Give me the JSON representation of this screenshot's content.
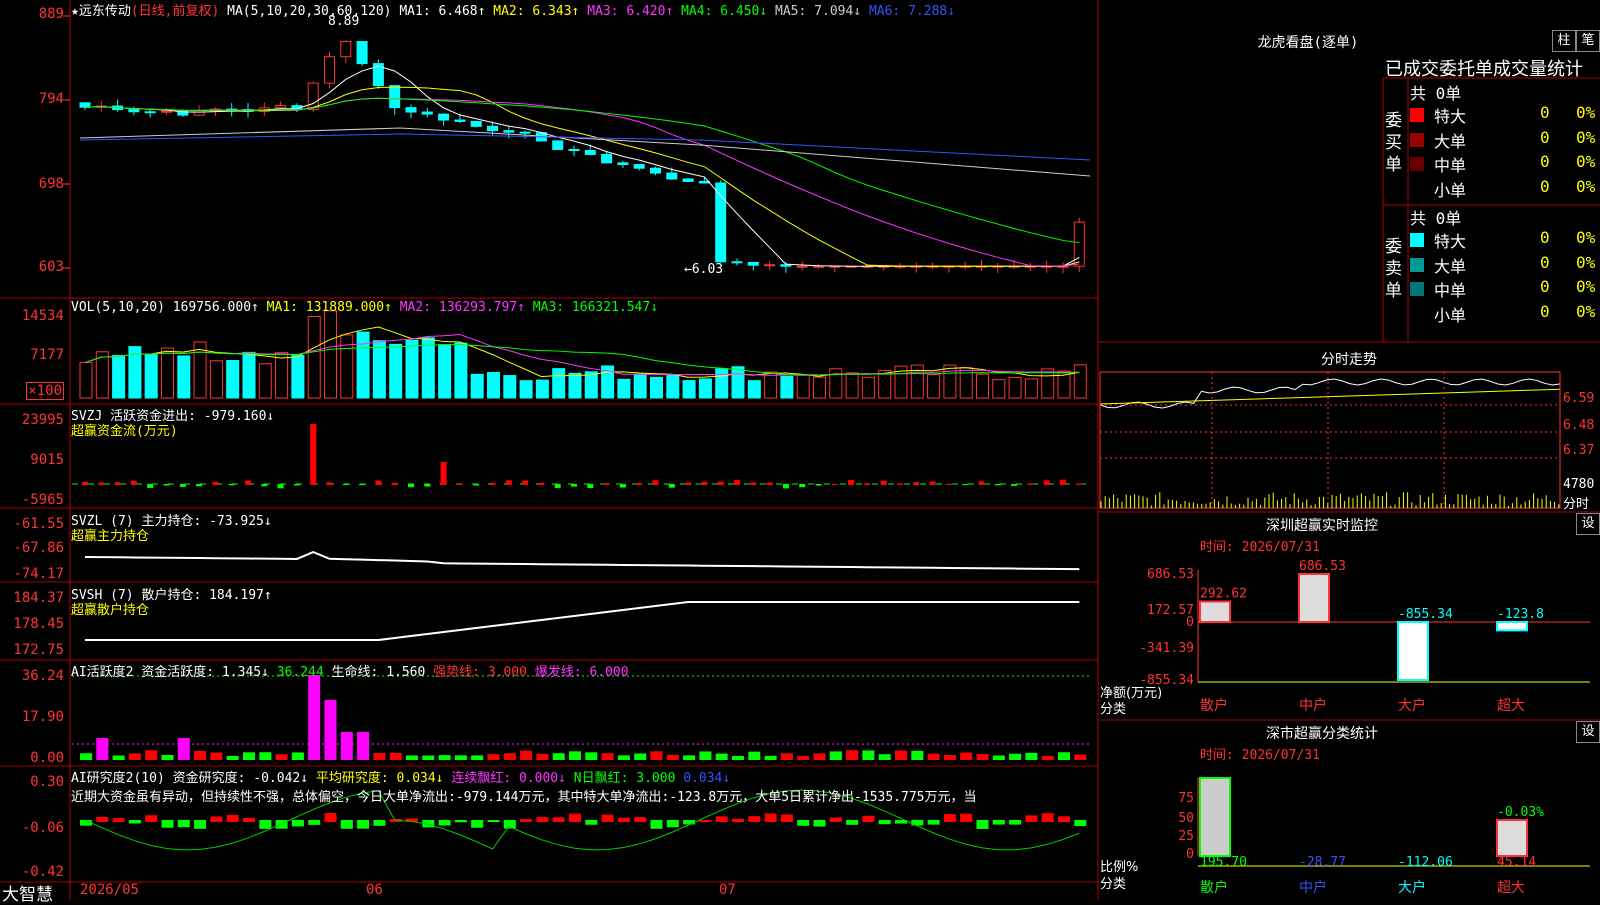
{
  "main": {
    "stock_name": "★远东传动",
    "period_tag": "(日线,前复权)",
    "ma_params": "MA(5,10,20,30,60,120)",
    "ma_values": [
      {
        "text": "MA1: 6.468↑",
        "color": "#ffffff"
      },
      {
        "text": "MA2: 6.343↑",
        "color": "#ffff00"
      },
      {
        "text": "MA3: 6.420↑",
        "color": "#ff33ff"
      },
      {
        "text": "MA4: 6.450↓",
        "color": "#00ff00"
      },
      {
        "text": "MA5: 7.094↓",
        "color": "#cccccc"
      },
      {
        "text": "MA6: 7.288↓",
        "color": "#3355ff"
      }
    ],
    "y_ticks": [
      "889",
      "794",
      "698",
      "603"
    ],
    "high_label": "8.89",
    "low_label": "←6.03"
  },
  "vol": {
    "header": [
      {
        "text": "VOL(5,10,20)",
        "color": "#ffffff"
      },
      {
        "text": "169756.000↑",
        "color": "#ffffff"
      },
      {
        "text": "MA1: 131889.000↑",
        "color": "#ffff00"
      },
      {
        "text": "MA2: 136293.797↑",
        "color": "#ff33ff"
      },
      {
        "text": "MA3: 166321.547↓",
        "color": "#00ff00"
      }
    ],
    "y_ticks": [
      "14534",
      "7177",
      "×100"
    ]
  },
  "svzj": {
    "header": "SVZJ  活跃资金进出: -979.160↓",
    "subtitle": "超赢资金流(万元)",
    "y_ticks": [
      "23995",
      "9015",
      "-5965"
    ]
  },
  "svzl": {
    "header": "SVZL (7) 主力持仓: -73.925↓",
    "subtitle": "超赢主力持仓",
    "y_ticks": [
      "-61.55",
      "-67.86",
      "-74.17"
    ]
  },
  "svsh": {
    "header": "SVSH (7) 散户持仓: 184.197↑",
    "subtitle": "超赢散户持仓",
    "y_ticks": [
      "184.37",
      "178.45",
      "172.75"
    ]
  },
  "ai1": {
    "header": [
      {
        "text": "AI活跃度2 资金活跃度: 1.345↓",
        "color": "#ffffff"
      },
      {
        "text": "36.244",
        "color": "#00ff00"
      },
      {
        "text": "生命线: 1.560",
        "color": "#ffffff"
      },
      {
        "text": "强势线: 3.000",
        "color": "#ff3333"
      },
      {
        "text": "爆发线: 6.000",
        "color": "#ff33ff"
      }
    ],
    "y_ticks": [
      "36.24",
      "17.90",
      "0.00"
    ]
  },
  "ai2": {
    "header": [
      {
        "text": "AI研究度2(10) 资金研究度: -0.042↓",
        "color": "#ffffff"
      },
      {
        "text": "平均研究度: 0.034↓",
        "color": "#ffff00"
      },
      {
        "text": "连续飘红: 0.000↓",
        "color": "#ff33ff"
      },
      {
        "text": "N日飘红: 3.000",
        "color": "#00ff00"
      },
      {
        "text": "0.034↓",
        "color": "#3355ff"
      }
    ],
    "commentary": "近期大资金虽有异动，但持续性不强，总体偏空，今日大单净流出:-979.144万元，其中特大单净流出:-123.8万元，大单5日累计净出-1535.775万元，当",
    "y_ticks": [
      "0.30",
      "-0.06",
      "-0.42"
    ]
  },
  "xaxis": {
    "labels": [
      "2026/05",
      "06",
      "07"
    ]
  },
  "brand": "大智慧",
  "lhb": {
    "title": "龙虎看盘(逐单)",
    "btn_col": "柱",
    "btn_stroke": "笔",
    "subtitle": "已成交委托单成交量统计",
    "buy_label": "委买单",
    "sell_label": "委卖单",
    "buy_total": "共 0单",
    "sell_total": "共 0单",
    "buy_rows": [
      {
        "label": "特大",
        "n": "0",
        "p": "0%",
        "color": "#ff0000"
      },
      {
        "label": "大单",
        "n": "0",
        "p": "0%",
        "color": "#990000"
      },
      {
        "label": "中单",
        "n": "0",
        "p": "0%",
        "color": "#660000"
      },
      {
        "label": "小单",
        "n": "0",
        "p": "0%",
        "color": "#000000"
      }
    ],
    "sell_rows": [
      {
        "label": "特大",
        "n": "0",
        "p": "0%",
        "color": "#00ffff"
      },
      {
        "label": "大单",
        "n": "0",
        "p": "0%",
        "color": "#009999"
      },
      {
        "label": "中单",
        "n": "0",
        "p": "0%",
        "color": "#007777"
      },
      {
        "label": "小单",
        "n": "0",
        "p": "0%",
        "color": "#000000"
      }
    ]
  },
  "fenshi": {
    "title": "分时走势",
    "y_ticks": [
      "6.59",
      "6.48",
      "6.37"
    ],
    "vol_tick": "4780",
    "vol_label": "分时"
  },
  "monitor": {
    "title": "深圳超赢实时监控",
    "btn": "设",
    "time": "时间: 2026/07/31",
    "y_ticks": [
      "686.53",
      "172.57",
      "0",
      "-341.39",
      "-855.34"
    ],
    "ylabel1": "净额(万元)",
    "ylabel2": "分类",
    "categories": [
      "散户",
      "中户",
      "大户",
      "超大"
    ],
    "values": [
      292.62,
      686.53,
      -855.34,
      -123.8
    ],
    "value_labels": [
      "292.62",
      "686.53",
      "-855.34",
      "-123.8"
    ]
  },
  "classify": {
    "title": "深市超赢分类统计",
    "btn": "设",
    "time": "时间: 2026/07/31",
    "y_ticks": [
      "75",
      "50",
      "25",
      "0"
    ],
    "ylabel1": "比例%",
    "ylabel2": "分类",
    "categories": [
      "散户",
      "中户",
      "大户",
      "超大"
    ],
    "values": [
      "195.70",
      "-28.77",
      "-112.06",
      "45.14"
    ],
    "top_label": "-0.03%"
  }
}
